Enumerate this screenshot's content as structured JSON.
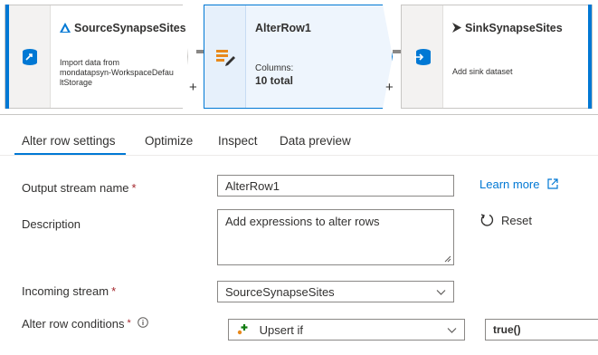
{
  "pipeline": {
    "source": {
      "title": "SourceSynapseSites",
      "desc_line1": "Import data from",
      "desc_line2": "mondatapsyn-WorkspaceDefau",
      "desc_line3": "ltStorage",
      "icon": "synapse-icon",
      "type_icon": "dataset-source-icon"
    },
    "alter": {
      "title": "AlterRow1",
      "columns_label": "Columns:",
      "columns_value": "10 total",
      "icon": "alter-row-icon"
    },
    "sink": {
      "title": "SinkSynapseSites",
      "desc": "Add sink dataset",
      "icon": "synapse-icon",
      "type_icon": "dataset-sink-icon"
    },
    "add_symbol": "+"
  },
  "tabs": [
    {
      "label": "Alter row settings",
      "active": true
    },
    {
      "label": "Optimize",
      "active": false
    },
    {
      "label": "Inspect",
      "active": false
    },
    {
      "label": "Data preview",
      "active": false
    }
  ],
  "form": {
    "output_stream": {
      "label": "Output stream name",
      "required_mark": "*",
      "value": "AlterRow1"
    },
    "description": {
      "label": "Description",
      "value": "Add expressions to alter rows"
    },
    "incoming_stream": {
      "label": "Incoming stream",
      "required_mark": "*",
      "value": "SourceSynapseSites"
    },
    "alter_conditions": {
      "label": "Alter row conditions",
      "required_mark": "*",
      "condition_type": "Upsert if",
      "expression": "true()"
    },
    "learn_more": "Learn more",
    "reset": "Reset"
  },
  "colors": {
    "accent": "#0078d4",
    "required": "#a4262c",
    "border": "#8a8886"
  }
}
